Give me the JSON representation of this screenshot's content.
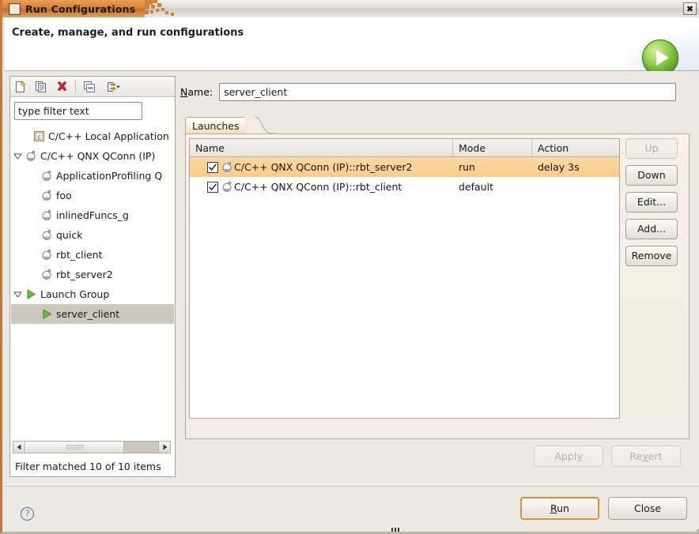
{
  "window": {
    "title": "Run Configurations",
    "close_label": "✖",
    "icon": "window-icon"
  },
  "header": {
    "title": "Create, manage, and run configurations",
    "banner_icon": "run-launch-icon"
  },
  "left_panel": {
    "toolbar": [
      {
        "name": "new-launch-configuration-icon",
        "tooltip": "New launch configuration"
      },
      {
        "name": "duplicate-launch-configuration-icon",
        "tooltip": "Duplicate"
      },
      {
        "name": "delete-launch-configuration-icon",
        "tooltip": "Delete"
      },
      {
        "name": "collapse-all-icon",
        "tooltip": "Collapse All"
      },
      {
        "name": "filter-launch-configurations-icon",
        "tooltip": "Filter"
      }
    ],
    "filter": {
      "value": "type filter text",
      "placeholder": "type filter text"
    },
    "tree": [
      {
        "label": "C/C++ Local Application",
        "icon": "c-local-app-icon",
        "indent": 1,
        "twisty": "none",
        "selected": false
      },
      {
        "label": "C/C++ QNX QConn (IP)",
        "icon": "qnx-qconn-icon",
        "indent": 0,
        "twisty": "expanded",
        "selected": false
      },
      {
        "label": "ApplicationProfiling Q",
        "icon": "qnx-qconn-icon",
        "indent": 2,
        "twisty": "none",
        "selected": false
      },
      {
        "label": "foo",
        "icon": "qnx-qconn-icon",
        "indent": 2,
        "twisty": "none",
        "selected": false
      },
      {
        "label": "inlinedFuncs_g",
        "icon": "qnx-qconn-icon",
        "indent": 2,
        "twisty": "none",
        "selected": false
      },
      {
        "label": "quick",
        "icon": "qnx-qconn-icon",
        "indent": 2,
        "twisty": "none",
        "selected": false
      },
      {
        "label": "rbt_client",
        "icon": "qnx-qconn-icon",
        "indent": 2,
        "twisty": "none",
        "selected": false
      },
      {
        "label": "rbt_server2",
        "icon": "qnx-qconn-icon",
        "indent": 2,
        "twisty": "none",
        "selected": false
      },
      {
        "label": "Launch Group",
        "icon": "launch-group-icon",
        "indent": 0,
        "twisty": "expanded",
        "selected": false
      },
      {
        "label": "server_client",
        "icon": "launch-group-icon",
        "indent": 2,
        "twisty": "none",
        "selected": true
      }
    ],
    "status": "Filter matched 10 of 10 items"
  },
  "right_panel": {
    "name_label_pre": "",
    "name_label_mn": "N",
    "name_label_post": "ame:",
    "name_value": "server_client",
    "tabs": [
      {
        "label": "Launches",
        "active": true
      }
    ],
    "table": {
      "columns": [
        {
          "key": "name",
          "label": "Name"
        },
        {
          "key": "mode",
          "label": "Mode"
        },
        {
          "key": "action",
          "label": "Action"
        }
      ],
      "rows": [
        {
          "checked": true,
          "icon": "qnx-qconn-icon",
          "name": "C/C++ QNX QConn (IP)::rbt_server2",
          "mode": "run",
          "action": "delay 3s",
          "selected": true
        },
        {
          "checked": true,
          "icon": "qnx-qconn-icon",
          "name": "C/C++ QNX QConn (IP)::rbt_client",
          "mode": "default",
          "action": "",
          "selected": false
        }
      ]
    },
    "side_buttons": [
      {
        "label": "Up",
        "enabled": false
      },
      {
        "label": "Down",
        "enabled": true
      },
      {
        "label": "Edit...",
        "enabled": true
      },
      {
        "label": "Add...",
        "enabled": true
      },
      {
        "label": "Remove",
        "enabled": true
      }
    ],
    "apply_button": {
      "pre": "Appl",
      "mn": "y",
      "post": "",
      "enabled": false
    },
    "revert_button": {
      "pre": "Re",
      "mn": "v",
      "post": "ert",
      "enabled": false
    }
  },
  "footer": {
    "help_icon": "help-icon",
    "help_glyph": "?",
    "run_button": {
      "pre": "",
      "mn": "R",
      "post": "un"
    },
    "close_button": {
      "label": "Close"
    }
  },
  "colors": {
    "title_active": "#d4892f",
    "selection_orange": "#f9cb88",
    "selection_gray": "#cdc7bd",
    "focus_orange": "#e08a2e",
    "dialog_bg": "#ece9e3",
    "run_green": "#6eb52e"
  }
}
